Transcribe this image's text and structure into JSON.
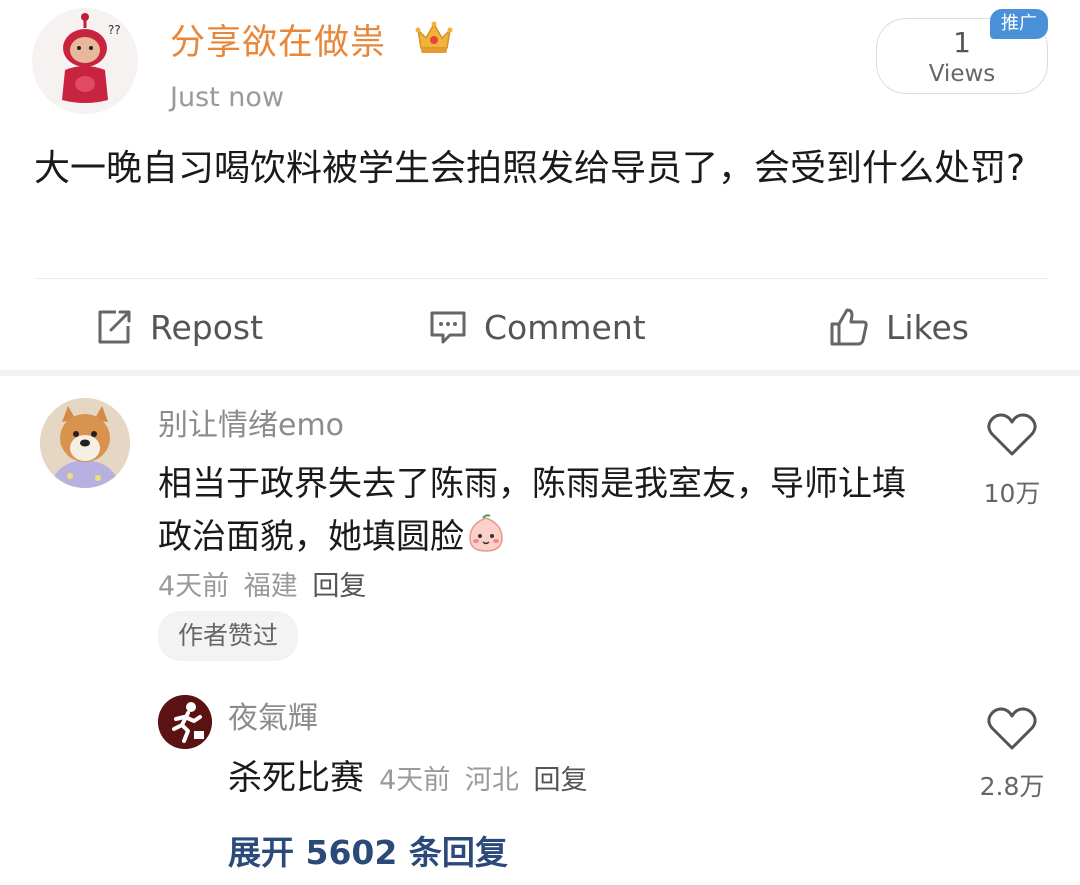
{
  "post": {
    "username": "分享欲在做祟",
    "timestamp": "Just now",
    "views_count": "1",
    "views_label": "Views",
    "promo_badge": "推广",
    "text": "大一晚自习喝饮料被学生会拍照发给导员了，会受到什么处罚?",
    "accent_color": "#e8873a"
  },
  "actions": {
    "repost": "Repost",
    "comment": "Comment",
    "likes": "Likes"
  },
  "comments": [
    {
      "username": "别让情绪emo",
      "text": "相当于政界失去了陈雨，陈雨是我室友，导师让填政治面貌，她填圆脸",
      "time": "4天前",
      "location": "福建",
      "reply_label": "回复",
      "author_liked": "作者赞过",
      "likes": "10万",
      "replies": [
        {
          "username": "夜氣輝",
          "text": "杀死比赛",
          "time": "4天前",
          "location": "河北",
          "reply_label": "回复",
          "likes": "2.8万"
        }
      ],
      "expand_label": "展开 5602 条回复"
    }
  ]
}
